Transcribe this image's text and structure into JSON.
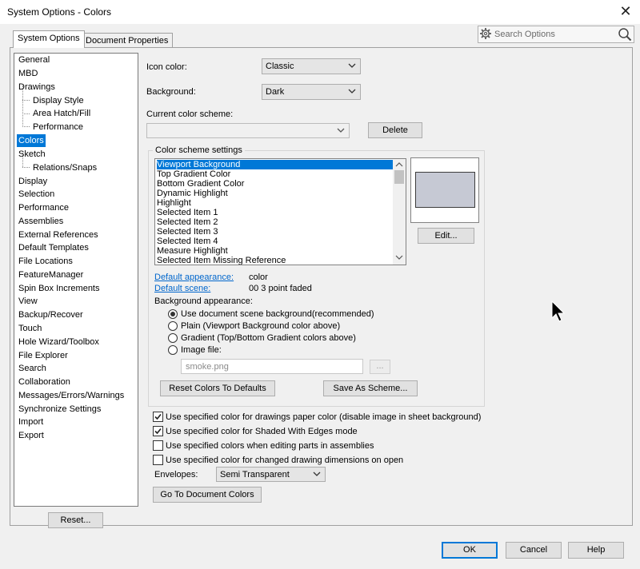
{
  "window": {
    "title": "System Options - Colors",
    "close_icon": "close-icon"
  },
  "tabs": [
    "System Options",
    "Document Properties"
  ],
  "search": {
    "placeholder": "Search Options"
  },
  "tree": {
    "items": [
      "General",
      "MBD",
      "Drawings",
      "Display Style",
      "Area Hatch/Fill",
      "Performance",
      "Colors",
      "Sketch",
      "Relations/Snaps",
      "Display",
      "Selection",
      "Performance",
      "Assemblies",
      "External References",
      "Default Templates",
      "File Locations",
      "FeatureManager",
      "Spin Box Increments",
      "View",
      "Backup/Recover",
      "Touch",
      "Hole Wizard/Toolbox",
      "File Explorer",
      "Search",
      "Collaboration",
      "Messages/Errors/Warnings",
      "Synchronize Settings",
      "Import",
      "Export"
    ],
    "selected": "Colors"
  },
  "reset_button": "Reset...",
  "icon_color": {
    "label": "Icon color:",
    "value": "Classic"
  },
  "background": {
    "label": "Background:",
    "value": "Dark"
  },
  "current_scheme": {
    "label": "Current color scheme:",
    "value": ""
  },
  "delete_button": "Delete",
  "scheme_settings": {
    "title": "Color scheme settings",
    "items": [
      "Viewport Background",
      "Top Gradient Color",
      "Bottom Gradient Color",
      "Dynamic Highlight",
      "Highlight",
      "Selected Item 1",
      "Selected Item 2",
      "Selected Item 3",
      "Selected Item 4",
      "Measure Highlight",
      "Selected Item Missing Reference"
    ],
    "selected": "Viewport Background",
    "edit_button": "Edit...",
    "preview_color": "#c6c9d4"
  },
  "default_appearance": {
    "label": "Default appearance:",
    "value": "color"
  },
  "default_scene": {
    "label": "Default scene:",
    "value": "00 3 point faded"
  },
  "background_appearance": {
    "label": "Background appearance:",
    "options": [
      "Use document scene background(recommended)",
      "Plain (Viewport Background color above)",
      "Gradient (Top/Bottom Gradient colors above)",
      "Image file:"
    ],
    "selected": 0,
    "image_file": "smoke.png",
    "browse_label": "..."
  },
  "reset_colors_button": "Reset Colors To Defaults",
  "save_scheme_button": "Save As Scheme...",
  "checkboxes": [
    {
      "label": "Use specified color for drawings paper color (disable image in sheet background)",
      "checked": true
    },
    {
      "label": "Use specified color for Shaded With Edges mode",
      "checked": true
    },
    {
      "label": "Use specified colors when editing parts in assemblies",
      "checked": false
    },
    {
      "label": "Use specified color for changed drawing dimensions on open",
      "checked": false
    }
  ],
  "envelopes": {
    "label": "Envelopes:",
    "value": "Semi Transparent"
  },
  "doc_colors_button": "Go To Document Colors",
  "footer": {
    "ok": "OK",
    "cancel": "Cancel",
    "help": "Help"
  },
  "colors": {
    "selection": "#0078d7",
    "link": "#0066cc"
  }
}
